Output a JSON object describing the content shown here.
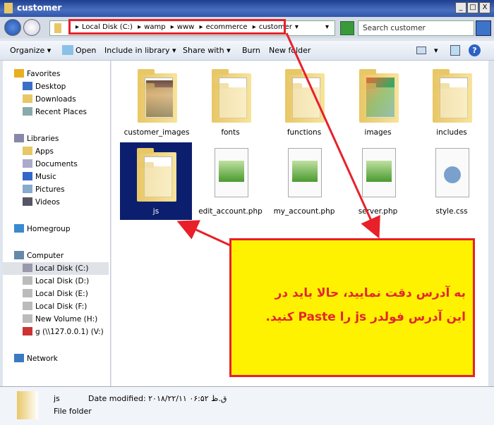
{
  "window": {
    "title": "customer",
    "controls": [
      "_",
      "□",
      "X"
    ]
  },
  "address": {
    "segments": [
      "Local Disk (C:)",
      "wamp",
      "www",
      "ecommerce",
      "customer"
    ]
  },
  "search": {
    "placeholder": "Search customer"
  },
  "toolbar": {
    "organize": "Organize ▾",
    "open": "Open",
    "include": "Include in library ▾",
    "share": "Share with ▾",
    "burn": "Burn",
    "new_folder": "New folder"
  },
  "sidebar": {
    "favorites": {
      "label": "Favorites",
      "items": [
        "Desktop",
        "Downloads",
        "Recent Places"
      ]
    },
    "libraries": {
      "label": "Libraries",
      "items": [
        "Apps",
        "Documents",
        "Music",
        "Pictures",
        "Videos"
      ]
    },
    "homegroup": "Homegroup",
    "computer": {
      "label": "Computer",
      "items": [
        "Local Disk (C:)",
        "Local Disk (D:)",
        "Local Disk (E:)",
        "Local Disk (F:)",
        "New Volume (H:)",
        "g (\\\\127.0.0.1) (V:)"
      ]
    },
    "network": "Network"
  },
  "files": [
    {
      "name": "customer_images",
      "type": "folder-photo"
    },
    {
      "name": "fonts",
      "type": "folder"
    },
    {
      "name": "functions",
      "type": "folder"
    },
    {
      "name": "images",
      "type": "folder-image"
    },
    {
      "name": "includes",
      "type": "folder"
    },
    {
      "name": "js",
      "type": "folder",
      "selected": true
    },
    {
      "name": "edit_account.php",
      "type": "php"
    },
    {
      "name": "my_account.php",
      "type": "php"
    },
    {
      "name": "server.php",
      "type": "php"
    },
    {
      "name": "style.css",
      "type": "css"
    }
  ],
  "details": {
    "name": "js",
    "date_modified": "Date modified: ۲۰۱۸/۲۲/۱۱ ق.ظ ۰۶:۵۲",
    "kind": "File folder"
  },
  "annotation": {
    "line1": "به آدرس دقت نمایید، حالا باید در",
    "line2": "این آدرس فولدر js را Paste کنید.",
    "colors": {
      "box": "#fff200",
      "border": "#e8202a"
    }
  }
}
